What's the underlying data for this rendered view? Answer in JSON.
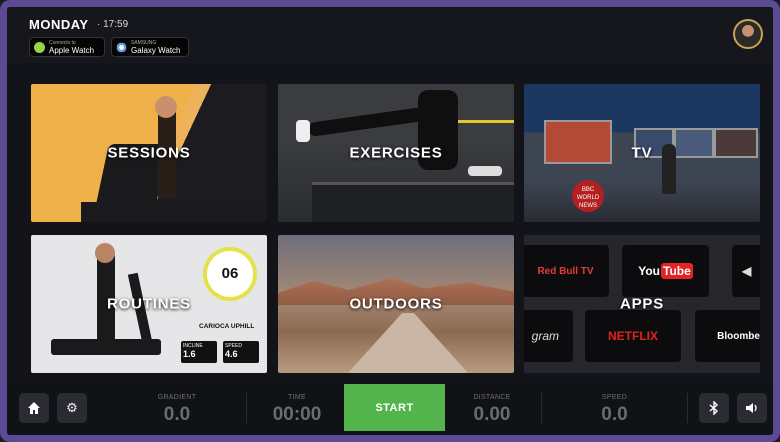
{
  "header": {
    "day": "MONDAY",
    "time": "17:59",
    "badges": [
      {
        "small": "Connects to",
        "label": "Apple Watch",
        "icon": "apple-watch-icon"
      },
      {
        "small": "SAMSUNG",
        "label": "Galaxy Watch",
        "icon": "samsung-watch-icon"
      }
    ],
    "avatar_icon": "user-avatar"
  },
  "tiles": {
    "sessions": "SESSIONS",
    "exercises": "EXERCISES",
    "tv": "TV",
    "routines": "ROUTINES",
    "outdoors": "OUTDOORS",
    "apps": "APPS"
  },
  "tv_news": "BBC WORLD NEWS",
  "routine_card": {
    "number": "06",
    "name": "CARIOCA UPHILL",
    "stats": [
      {
        "label": "INCLINE",
        "value": "1.6",
        "unit": "%"
      },
      {
        "label": "SPEED",
        "value": "4.6",
        "unit": "km/h"
      }
    ]
  },
  "apps": {
    "redbull": "Red Bull TV",
    "youtube_you": "You",
    "youtube_tube": "Tube",
    "partial": "",
    "instagram": "gram",
    "netflix": "NETFLIX",
    "bloomberg": "Bloombe"
  },
  "footer": {
    "home_icon": "home-icon",
    "settings_icon": "gear-icon",
    "metrics": [
      {
        "label": "GRADIENT",
        "value": "0.0"
      },
      {
        "label": "TIME",
        "value": "00:00"
      },
      {
        "label": "DISTANCE",
        "value": "0.00"
      },
      {
        "label": "SPEED",
        "value": "0.0"
      }
    ],
    "start_label": "START",
    "bluetooth_icon": "bluetooth-icon",
    "volume_icon": "volume-icon"
  },
  "colors": {
    "start": "#52b44a",
    "frame": "#5c4a94",
    "ring": "#e2e24a"
  }
}
